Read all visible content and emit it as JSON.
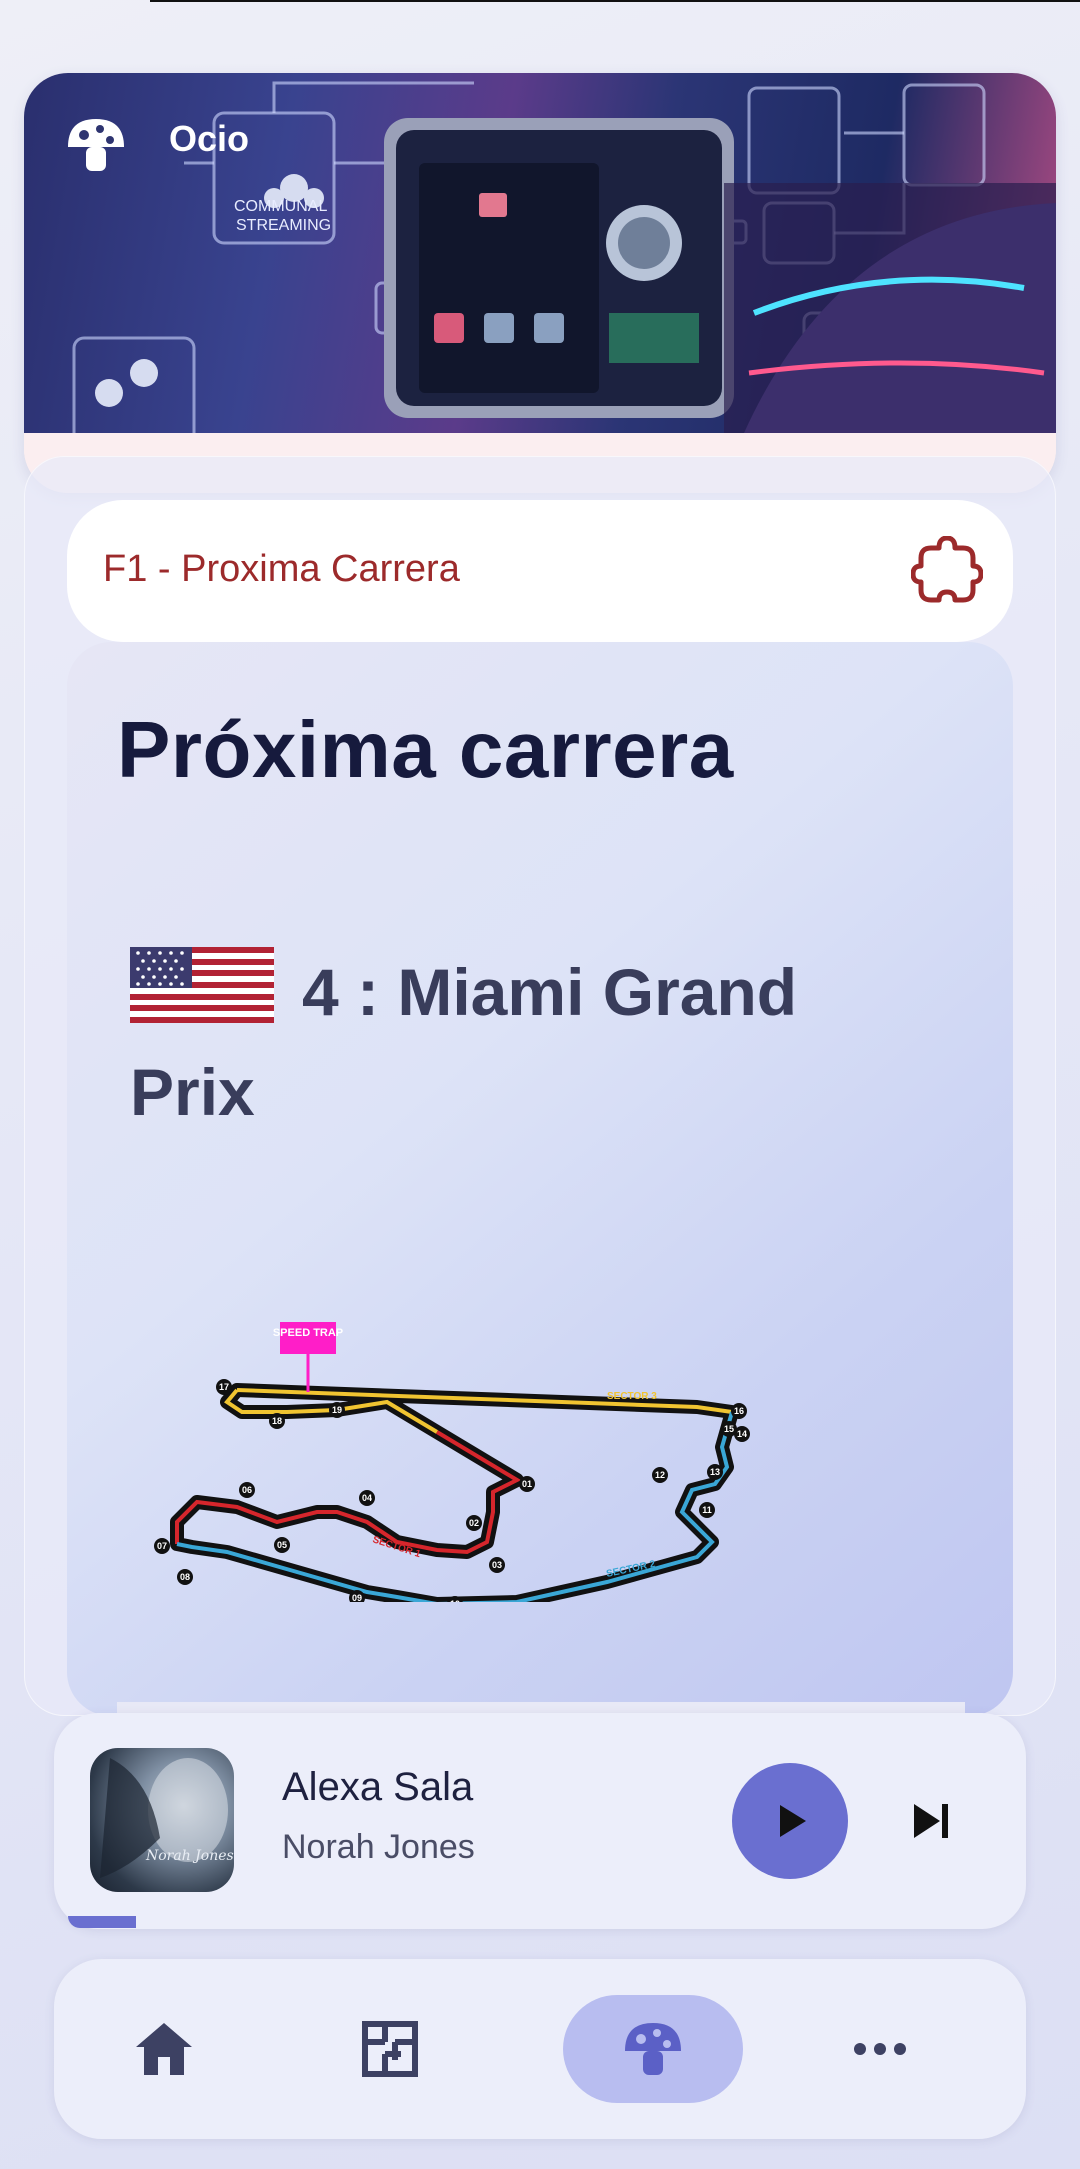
{
  "header": {
    "app_title": "Ocio",
    "logo_icon": "mushroom-icon"
  },
  "section": {
    "title": "F1 - Proxima Carrera",
    "action_icon": "puzzle-piece-icon"
  },
  "card": {
    "heading": "Próxima carrera",
    "race_line_1": "4 : Miami Grand",
    "race_line_2": "Prix",
    "flag_icon": "usa-flag-icon",
    "track_labels": {
      "speed_trap": "SPEED TRAP",
      "sector1": "SECTOR 1",
      "sector2": "SECTOR 2",
      "sector3": "SECTOR 3"
    }
  },
  "player": {
    "title": "Alexa Sala",
    "artist": "Norah Jones",
    "album_text": "Norah Jones",
    "play_icon": "play-icon",
    "next_icon": "skip-next-icon"
  },
  "nav": {
    "items": [
      {
        "icon": "home-icon"
      },
      {
        "icon": "floor-plan-icon"
      },
      {
        "icon": "mushroom-icon",
        "active": true
      },
      {
        "icon": "more-icon"
      }
    ]
  },
  "colors": {
    "accent": "#6a6fd0",
    "section_title": "#9c2a2b",
    "sector1": "#d6262c",
    "sector2": "#3aa7d6",
    "sector3": "#f0c431",
    "speed_trap": "#ff1ec8"
  }
}
